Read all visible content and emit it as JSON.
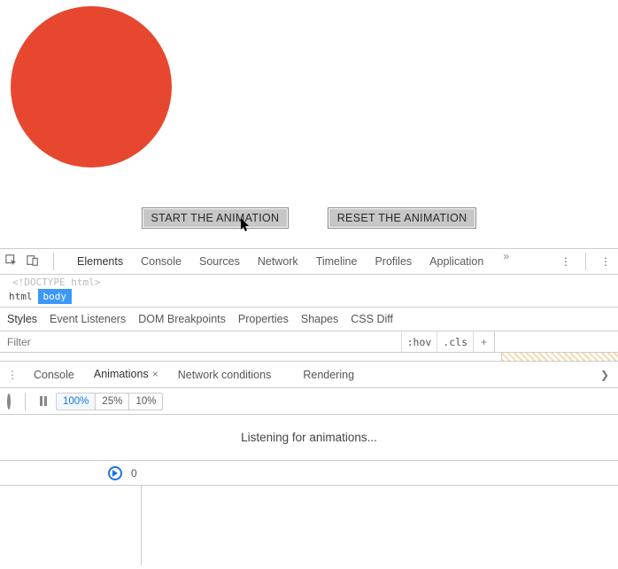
{
  "page": {
    "circle_color": "#e7472e",
    "start_label": "START THE ANIMATION",
    "reset_label": "RESET THE ANIMATION"
  },
  "devtools": {
    "tabs": [
      "Elements",
      "Console",
      "Sources",
      "Network",
      "Timeline",
      "Profiles",
      "Application"
    ],
    "selected_tab": "Elements",
    "doctype": "<!DOCTYPE html>",
    "crumbs": [
      "html",
      "body"
    ],
    "selected_crumb": "body",
    "subtabs": [
      "Styles",
      "Event Listeners",
      "DOM Breakpoints",
      "Properties",
      "Shapes",
      "CSS Diff"
    ],
    "selected_subtab": "Styles",
    "filter_placeholder": "Filter",
    "hov_label": ":hov",
    "cls_label": ".cls"
  },
  "drawer": {
    "tabs": [
      {
        "label": "Console",
        "closable": false
      },
      {
        "label": "Animations",
        "closable": true
      },
      {
        "label": "Network conditions",
        "closable": false
      },
      {
        "label": "Rendering",
        "closable": false
      }
    ],
    "selected": "Animations"
  },
  "animations": {
    "speeds": [
      "100%",
      "25%",
      "10%"
    ],
    "selected_speed": "100%",
    "status_text": "Listening for animations...",
    "time_origin": "0"
  }
}
